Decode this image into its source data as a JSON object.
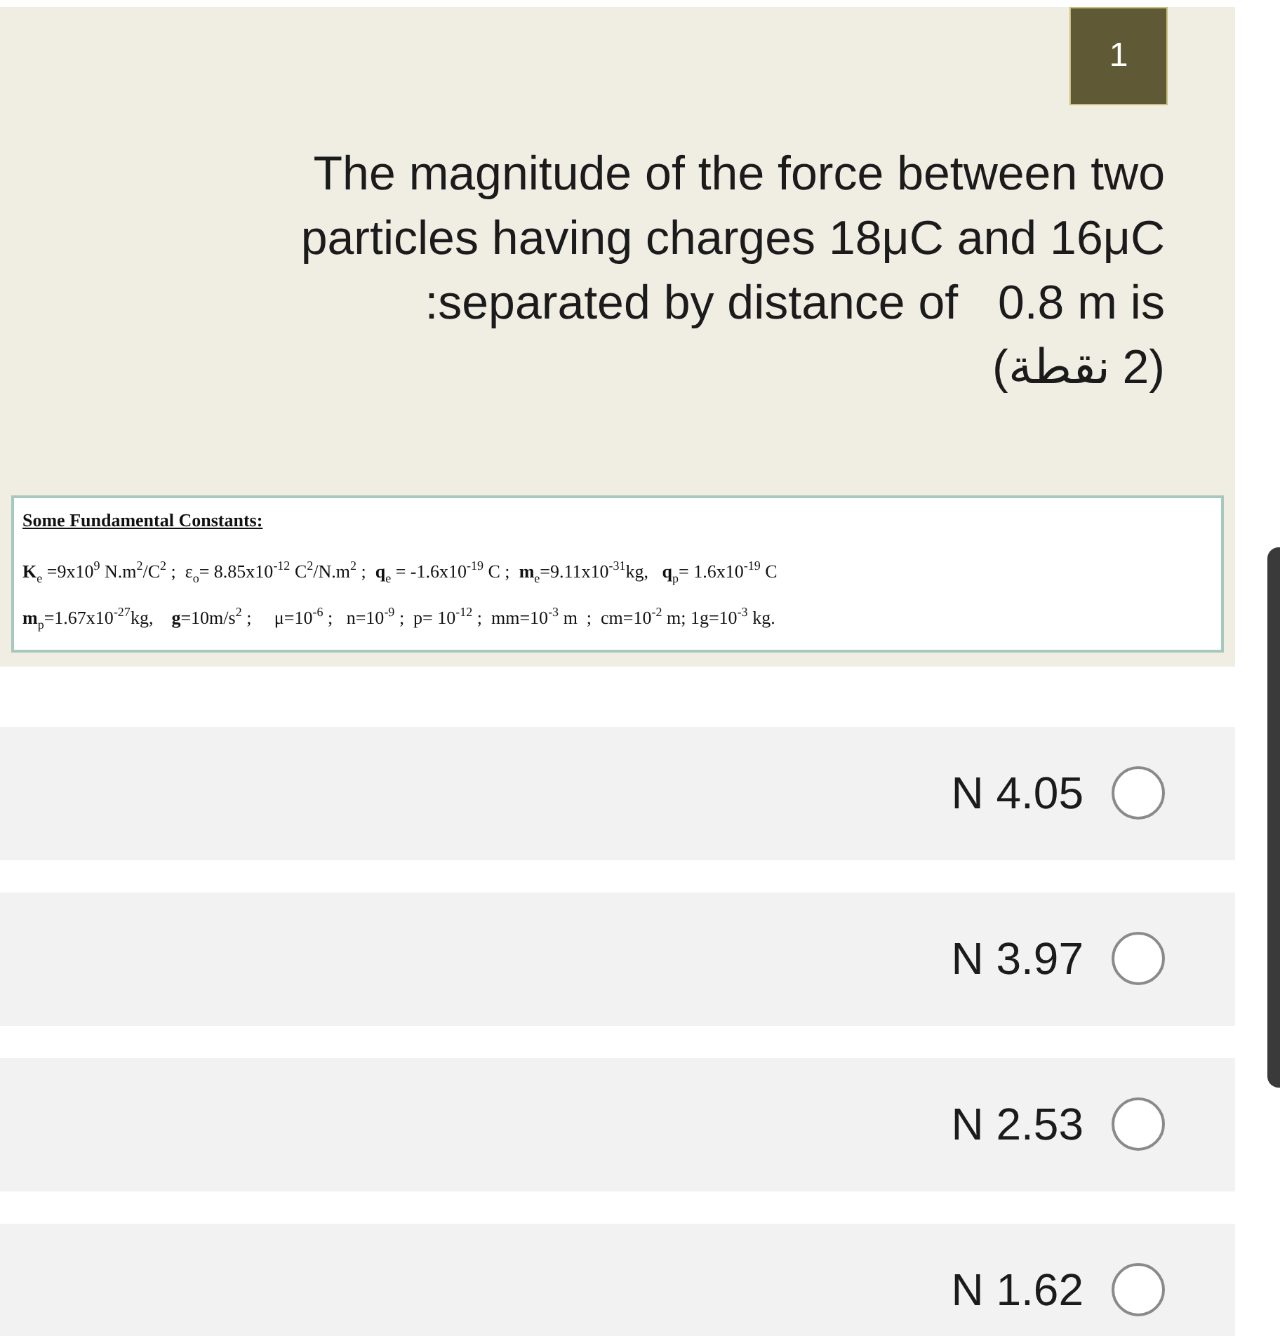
{
  "question": {
    "number": "1",
    "lines": [
      "The magnitude of the force between two",
      "particles having charges 18μC and 16μC",
      ":separated by distance of   0.8 m is"
    ],
    "points": "(2 نقطة)"
  },
  "constants": {
    "title": "Some Fundamental Constants:",
    "lines": [
      "**K**$_{e}$ =9x10$^{9}$ N.m$^{2}$/C$^{2}$ ;  ε$_{o}$= 8.85x10$^{-12}$ C$^{2}$/N.m$^{2}$ ;  **q**$_{e}$ = -1.6x10$^{-19}$ C ;  **m**$_{e}$=9.11x10$^{-31}$kg,   **q**$_{p}$= 1.6x10$^{-19}$ C",
      "**m**$_{p}$=1.67x10$^{-27}$kg,    **g**=10m/s$^{2}$ ;     μ=10$^{-6}$ ;   n=10$^{-9}$ ;  p= 10$^{-12}$ ;  mm=10$^{-3}$ m  ;  cm=10$^{-2}$ m; 1g=10$^{-3}$ kg."
    ]
  },
  "options": [
    {
      "label": "N 4.05",
      "selected": false
    },
    {
      "label": "N 3.97",
      "selected": false
    },
    {
      "label": "N 2.53",
      "selected": false
    },
    {
      "label": "N 1.62",
      "selected": false
    }
  ]
}
